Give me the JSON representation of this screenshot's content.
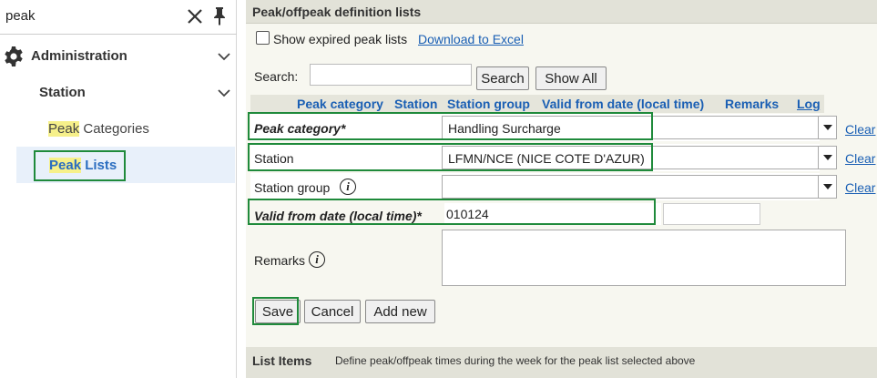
{
  "sidebar": {
    "search_query": "peak",
    "items": [
      {
        "label": "Administration"
      },
      {
        "label": "Station"
      },
      {
        "label_highlight": "Peak",
        "label_rest": " Categories"
      },
      {
        "label_highlight": "Peak",
        "label_rest": " Lists"
      }
    ]
  },
  "panel": {
    "title": "Peak/offpeak definition lists",
    "show_expired_label": "Show expired peak lists",
    "download_label": "Download to Excel",
    "search_label": "Search:",
    "search_value": "",
    "search_button": "Search",
    "show_all_button": "Show All",
    "columns": [
      "Peak category",
      "Station",
      "Station group",
      "Valid from date (local time)",
      "Remarks",
      "Log"
    ]
  },
  "form": {
    "peak_category": {
      "label": "Peak category*",
      "value": "Handling Surcharge",
      "clear": "Clear"
    },
    "station": {
      "label": "Station",
      "value": "LFMN/NCE (NICE COTE D'AZUR)",
      "clear": "Clear"
    },
    "station_group": {
      "label": "Station group",
      "value": "",
      "clear": "Clear"
    },
    "valid_from": {
      "label": "Valid from date (local time)*",
      "value": "010124"
    },
    "remarks": {
      "label": "Remarks",
      "value": ""
    },
    "save_button": "Save",
    "cancel_button": "Cancel",
    "add_new_button": "Add new"
  },
  "list_items": {
    "title": "List Items",
    "description": "Define peak/offpeak times during the week for the peak list selected above"
  },
  "colors": {
    "accent_link": "#1a5fb4",
    "highlight_box": "#1f8a3b",
    "search_highlight": "#f6f08a"
  }
}
